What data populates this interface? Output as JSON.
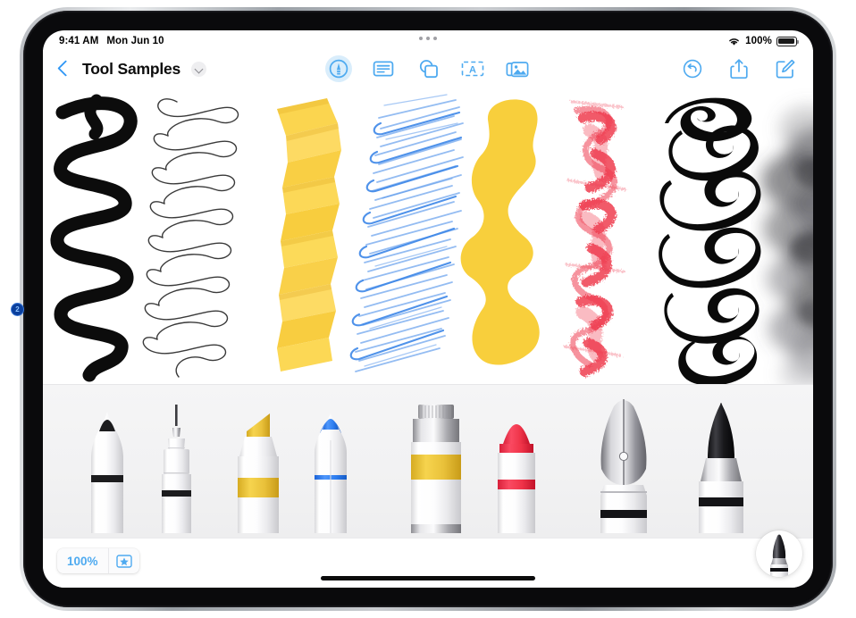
{
  "device": {
    "name": "iPad",
    "callout_marker": "2"
  },
  "status_bar": {
    "time": "9:41 AM",
    "date": "Mon Jun 10",
    "wifi_icon": "wifi-icon",
    "battery_percent": "100%",
    "battery_icon": "battery-full-icon",
    "multitask_handle": "multitasking-dots"
  },
  "nav_bar": {
    "back_label": "Back",
    "back_icon": "chevron-left-icon",
    "document_title": "Tool Samples",
    "title_menu_icon": "chevron-down-icon",
    "center_tools": [
      {
        "name": "markup-tool",
        "icon": "pen-circle-icon",
        "label": "Markup",
        "active": true
      },
      {
        "name": "note-tool",
        "icon": "note-lines-icon",
        "label": "Note",
        "active": false
      },
      {
        "name": "shapes-tool",
        "icon": "shapes-icon",
        "label": "Shapes",
        "active": false
      },
      {
        "name": "text-box-tool",
        "icon": "text-box-a-icon",
        "label": "Text Box",
        "active": false
      },
      {
        "name": "media-tool",
        "icon": "photos-icon",
        "label": "Media",
        "active": false
      }
    ],
    "right_tools": [
      {
        "name": "undo-button",
        "icon": "undo-circle-icon",
        "label": "Undo"
      },
      {
        "name": "share-button",
        "icon": "share-up-arrow-icon",
        "label": "Share"
      },
      {
        "name": "compose-button",
        "icon": "compose-pencil-icon",
        "label": "Compose"
      }
    ]
  },
  "canvas": {
    "label": "Drawing canvas",
    "samples": [
      {
        "name": "stroke-sample-pen-thick",
        "tool": "Pen",
        "color": "#111111",
        "description": "thick black squiggle"
      },
      {
        "name": "stroke-sample-thin-pen",
        "tool": "Fineliner",
        "color": "#3a3a3a",
        "description": "thin looping line"
      },
      {
        "name": "stroke-sample-highlighter",
        "tool": "Highlighter",
        "color": "#fbd44a",
        "description": "yellow chisel zigzag"
      },
      {
        "name": "stroke-sample-marker",
        "tool": "Marker",
        "color": "#3d87e8",
        "description": "blue scribble hatch"
      },
      {
        "name": "stroke-sample-paint",
        "tool": "Paint",
        "color": "#f7cf3c",
        "description": "yellow paint blob"
      },
      {
        "name": "stroke-sample-crayon",
        "tool": "Crayon",
        "color": "#ef3c4f",
        "description": "red crayon texture"
      },
      {
        "name": "stroke-sample-fountain-pen",
        "tool": "Fountain Pen",
        "color": "#0a0a0a",
        "description": "black calligraphic flourish"
      },
      {
        "name": "stroke-sample-watercolor",
        "tool": "Watercolor",
        "color": "#6d6d72",
        "description": "soft gray cloud wash"
      }
    ]
  },
  "tool_palette": {
    "label": "Tool palette",
    "tools": [
      {
        "name": "tool-pencil",
        "label": "Pencil",
        "accent": "#1c1c1e",
        "selected": false
      },
      {
        "name": "tool-fineliner",
        "label": "Fineliner",
        "accent": "#1c1c1e",
        "selected": false
      },
      {
        "name": "tool-highlighter",
        "label": "Highlighter",
        "accent": "#eec33c",
        "selected": false
      },
      {
        "name": "tool-marker",
        "label": "Marker",
        "accent": "#2f7ef0",
        "selected": false
      },
      {
        "name": "tool-paint-tube",
        "label": "Paint",
        "accent": "#e8c13a",
        "selected": false
      },
      {
        "name": "tool-crayon",
        "label": "Crayon",
        "accent": "#f0384e",
        "selected": false
      },
      {
        "name": "tool-fountain-pen",
        "label": "Fountain Pen",
        "accent": "#9b9b9f",
        "selected": true
      },
      {
        "name": "tool-brush",
        "label": "Brush",
        "accent": "#2a2a2c",
        "selected": false
      }
    ]
  },
  "bottom_bar": {
    "zoom_level": "100%",
    "favorites_icon": "star-box-icon",
    "favorites_label": "Favorites",
    "home_indicator": "home-indicator",
    "floating_tool": {
      "name": "selected-tool-fountain-pen",
      "label": "Fountain Pen"
    }
  },
  "colors": {
    "accent_blue": "#4eaaf0",
    "tint_blue": "#2f97f5",
    "canvas_white": "#ffffff",
    "palette_gray": "#f2f2f3"
  }
}
